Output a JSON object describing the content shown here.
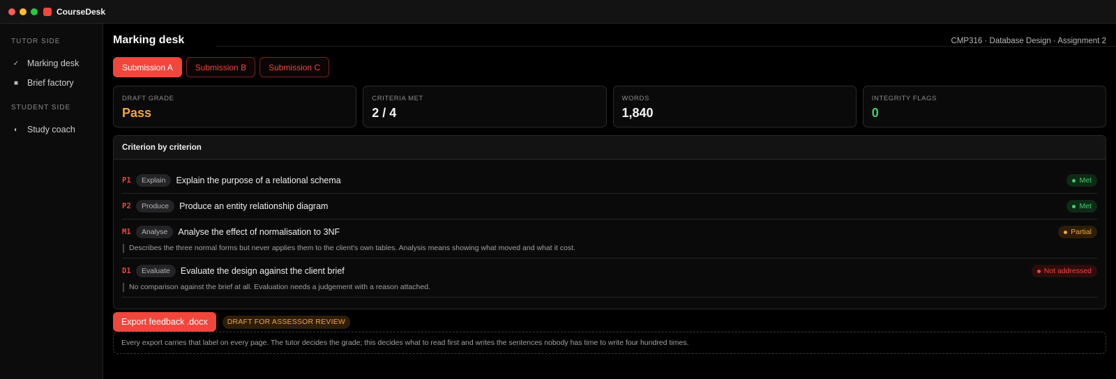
{
  "window": {
    "app_title": "CourseDesk",
    "traffic_colors": [
      "#ff5f57",
      "#febc2e",
      "#28c840"
    ]
  },
  "sidebar": {
    "tutor_section": "TUTOR SIDE",
    "student_section": "STUDENT SIDE",
    "items": [
      {
        "label": "Marking desk",
        "icon": "check-icon"
      },
      {
        "label": "Brief factory",
        "icon": "square-icon"
      },
      {
        "label": "Study coach",
        "icon": "half-circle-icon"
      }
    ]
  },
  "header": {
    "title": "Marking desk",
    "course": "CMP316 · Database Design · Assignment 2"
  },
  "tabs": [
    {
      "label": "Submission A",
      "active": true
    },
    {
      "label": "Submission B",
      "active": false
    },
    {
      "label": "Submission C",
      "active": false
    }
  ],
  "stats": [
    {
      "label": "DRAFT GRADE",
      "value": "Pass",
      "color": "#f3a640"
    },
    {
      "label": "CRITERIA MET",
      "value": "2 / 4",
      "color": "#f4f4f5"
    },
    {
      "label": "WORDS",
      "value": "1,840",
      "color": "#f4f4f5"
    },
    {
      "label": "INTEGRITY FLAGS",
      "value": "0",
      "color": "#3fcf6a"
    }
  ],
  "criteria": {
    "heading": "Criterion by criterion",
    "rows": [
      {
        "code": "P1",
        "verb": "Explain",
        "text": "Explain the purpose of a relational schema",
        "status": "Met",
        "status_kind": "met",
        "note": ""
      },
      {
        "code": "P2",
        "verb": "Produce",
        "text": "Produce an entity relationship diagram",
        "status": "Met",
        "status_kind": "met",
        "note": ""
      },
      {
        "code": "M1",
        "verb": "Analyse",
        "text": "Analyse the effect of normalisation to 3NF",
        "status": "Partial",
        "status_kind": "partial",
        "note": "Describes the three normal forms but never applies them to the client's own tables. Analysis means showing what moved and what it cost."
      },
      {
        "code": "D1",
        "verb": "Evaluate",
        "text": "Evaluate the design against the client brief",
        "status": "Not addressed",
        "status_kind": "none",
        "note": "No comparison against the brief at all. Evaluation needs a judgement with a reason attached."
      }
    ]
  },
  "actions": {
    "export_label": "Export feedback .docx",
    "draft_badge": "DRAFT FOR ASSESSOR REVIEW",
    "footer_note": "Every export carries that label on every page. The tutor decides the grade; this decides what to read first and writes the sentences nobody has time to write four hundred times."
  },
  "colors": {
    "accent": "#f0473d",
    "met": "#3fcf6a",
    "partial": "#f3a640"
  }
}
